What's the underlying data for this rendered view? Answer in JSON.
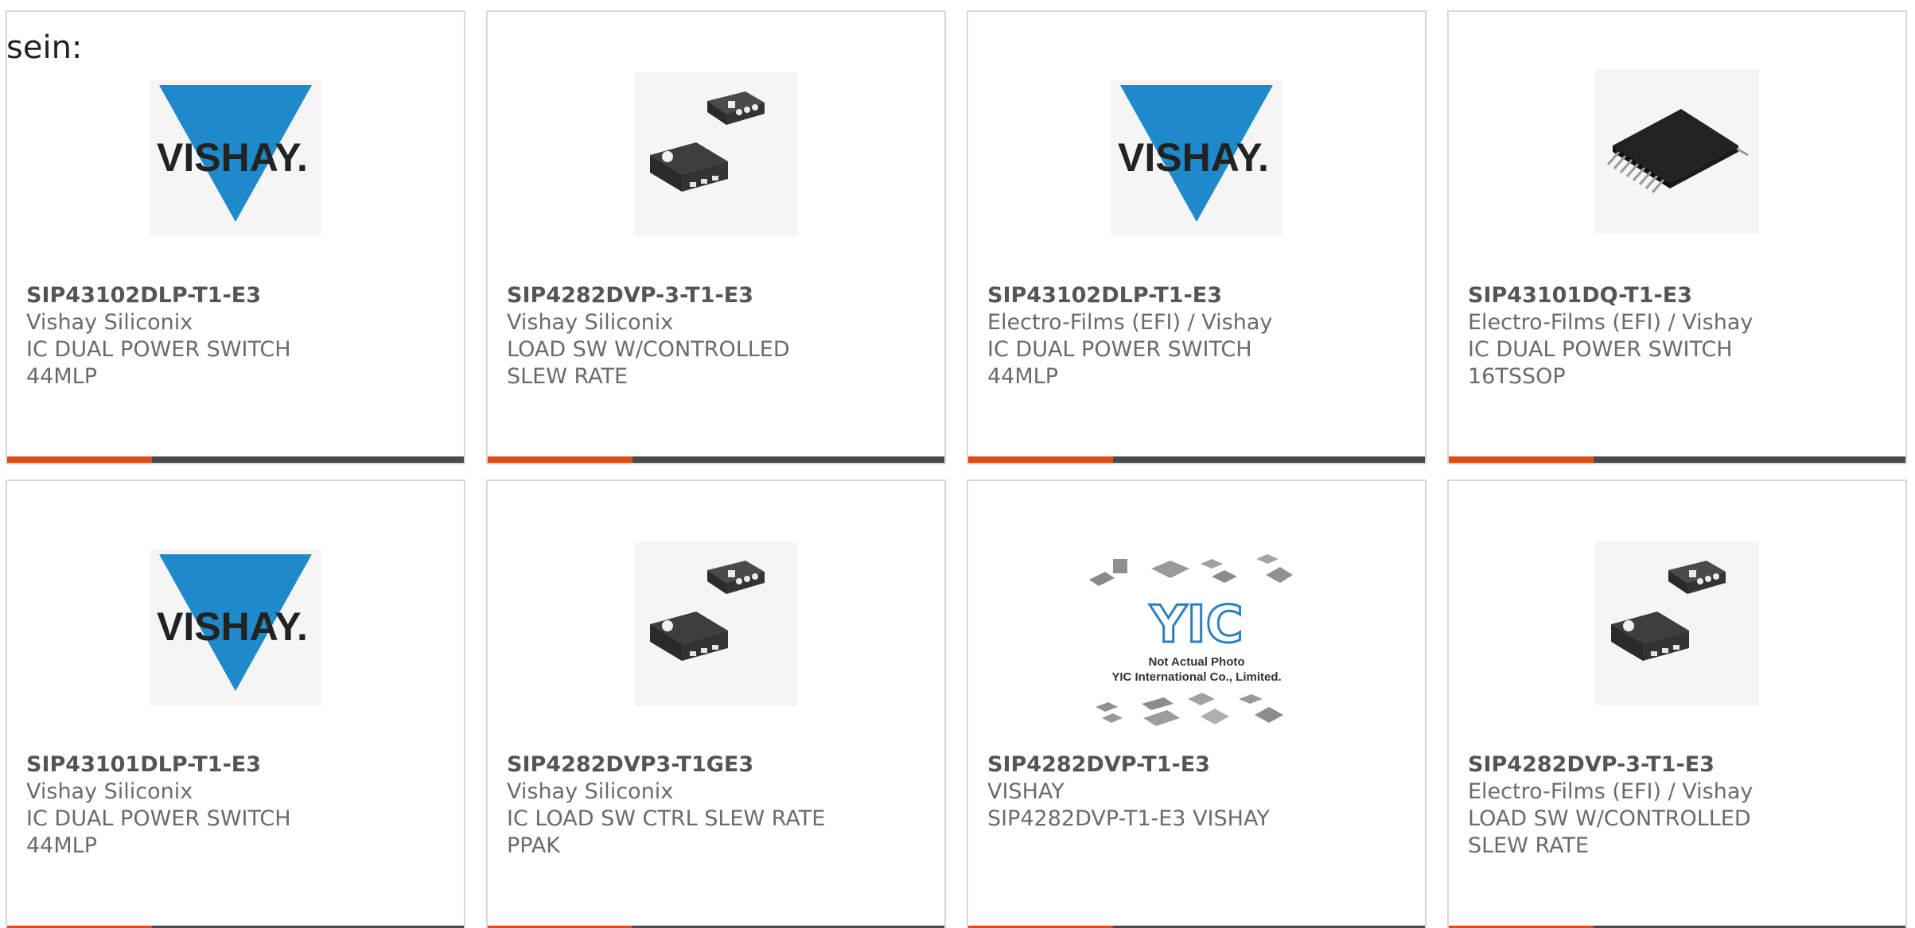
{
  "intro": {
    "text": "sein:"
  },
  "cards": [
    {
      "part_number": "SIP43102DLP-T1-E3",
      "manufacturer": "Vishay Siliconix",
      "description": "IC DUAL POWER SWITCH 44MLP",
      "image": "vishay-logo"
    },
    {
      "part_number": "SIP4282DVP-3-T1-E3",
      "manufacturer": "Vishay Siliconix",
      "description": "LOAD SW W/CONTROLLED SLEW RATE",
      "image": "chip-dfn-package"
    },
    {
      "part_number": "SIP43102DLP-T1-E3",
      "manufacturer": "Electro-Films (EFI) / Vishay",
      "description": "IC DUAL POWER SWITCH 44MLP",
      "image": "vishay-logo"
    },
    {
      "part_number": "SIP43101DQ-T1-E3",
      "manufacturer": "Electro-Films (EFI) / Vishay",
      "description": "IC DUAL POWER SWITCH 16TSSOP",
      "image": "chip-tssop-package"
    },
    {
      "part_number": "SIP43101DLP-T1-E3",
      "manufacturer": "Vishay Siliconix",
      "description": "IC DUAL POWER SWITCH 44MLP",
      "image": "vishay-logo"
    },
    {
      "part_number": "SIP4282DVP3-T1GE3",
      "manufacturer": "Vishay Siliconix",
      "description": "IC LOAD SW CTRL SLEW RATE PPAK",
      "image": "chip-dfn-package"
    },
    {
      "part_number": "SIP4282DVP-T1-E3",
      "manufacturer": "VISHAY",
      "description": "SIP4282DVP-T1-E3 VISHAY",
      "image": "yic-placeholder"
    },
    {
      "part_number": "SIP4282DVP-3-T1-E3",
      "manufacturer": "Electro-Films (EFI) / Vishay",
      "description": "LOAD SW W/CONTROLLED SLEW RATE",
      "image": "chip-dfn-package"
    }
  ],
  "vishay_logo_text": "VISHAY.",
  "yic_placeholder": {
    "logo_text": "YIC",
    "line1": "Not Actual Photo",
    "line2": "YIC International Co., Limited."
  },
  "colors": {
    "accent": "#e24b13",
    "bar": "#4a4a4a",
    "vishay_blue": "#1f8acb",
    "text": "#555555"
  }
}
